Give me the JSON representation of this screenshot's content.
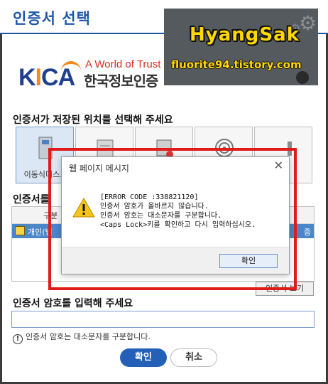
{
  "window": {
    "title": "인증서 선택"
  },
  "watermark": {
    "name": "HyangSak",
    "url": "fluorite94.tistory.com"
  },
  "logo": {
    "brand_k": "K",
    "brand_i": "I",
    "brand_ca": "CA",
    "tagline": "A World of Trust",
    "org_name": "한국정보인증"
  },
  "storage": {
    "label": "인증서가 저장된 위치를 선택해 주세요",
    "items": [
      {
        "label": "이동식디스크",
        "selected": true
      },
      {
        "label": ""
      },
      {
        "label": ""
      },
      {
        "label": ""
      },
      {
        "label": ""
      }
    ]
  },
  "cert_list": {
    "label": "인증서를",
    "header_col1": "구분",
    "row_text": "개인(범",
    "row_right": "증"
  },
  "view_cert_button": "인증서 보기",
  "password": {
    "label": "인증서 암호를 입력해 주세요",
    "value": "",
    "hint": "인증서 암호는 대소문자를 구분합니다."
  },
  "buttons": {
    "ok": "확인",
    "cancel": "취소"
  },
  "dialog": {
    "title": "웹 페이지 메시지",
    "close": "✕",
    "error_code": "[ERROR CODE :338821120]",
    "line1": "인증서 암호가 올바르지 않습니다.",
    "line2": "인증서 암호는 대소문자를 구분합니다.",
    "line3": "<Caps Lock>키를 확인하고 다시 입력하십시오.",
    "ok_label": "확인"
  },
  "colors": {
    "accent": "#1f57a6",
    "highlight": "#e11a1a",
    "row_selected": "#4a86c8"
  }
}
